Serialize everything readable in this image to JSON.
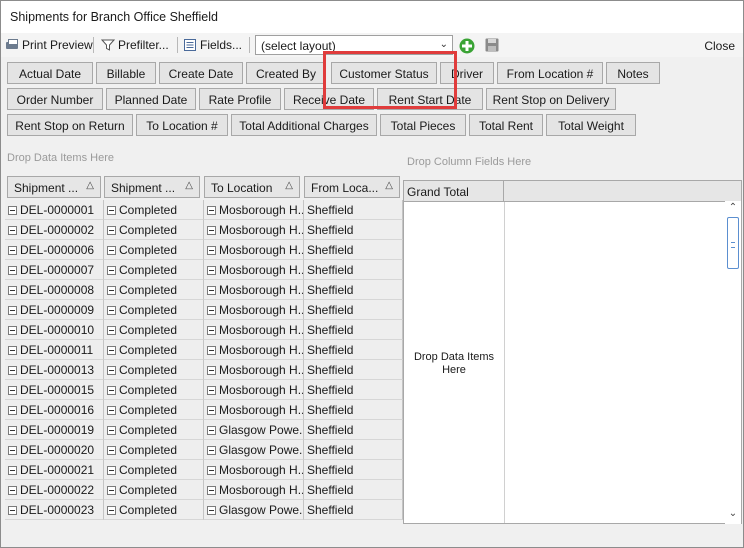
{
  "window": {
    "title": "Shipments for Branch Office Sheffield"
  },
  "toolbar": {
    "print_preview": "Print Preview",
    "prefilter": "Prefilter...",
    "fields": "Fields...",
    "layout_select": "(select layout)",
    "close": "Close"
  },
  "field_buttons": [
    "Actual Date",
    "Billable",
    "Create Date",
    "Created By",
    "Customer Status",
    "Driver",
    "From Location #",
    "Notes",
    "Order Number",
    "Planned Date",
    "Rate Profile",
    "Receive Date",
    "Rent Start Date",
    "Rent Stop on Delivery",
    "Rent Stop on Return",
    "To Location #",
    "Total Additional Charges",
    "Total Pieces",
    "Total Rent",
    "Total Weight"
  ],
  "hints": {
    "drop_data_items": "Drop Data Items Here",
    "drop_column_fields": "Drop Column Fields Here",
    "drop_data_items_pivot": "Drop Data Items Here"
  },
  "grid": {
    "columns": [
      "Shipment ...",
      "Shipment ...",
      "To Location",
      "From Loca..."
    ],
    "rows": [
      [
        "DEL-0000001",
        "Completed",
        "Mosborough H...",
        "Sheffield"
      ],
      [
        "DEL-0000002",
        "Completed",
        "Mosborough H...",
        "Sheffield"
      ],
      [
        "DEL-0000006",
        "Completed",
        "Mosborough H...",
        "Sheffield"
      ],
      [
        "DEL-0000007",
        "Completed",
        "Mosborough H...",
        "Sheffield"
      ],
      [
        "DEL-0000008",
        "Completed",
        "Mosborough H...",
        "Sheffield"
      ],
      [
        "DEL-0000009",
        "Completed",
        "Mosborough H...",
        "Sheffield"
      ],
      [
        "DEL-0000010",
        "Completed",
        "Mosborough H...",
        "Sheffield"
      ],
      [
        "DEL-0000011",
        "Completed",
        "Mosborough H...",
        "Sheffield"
      ],
      [
        "DEL-0000013",
        "Completed",
        "Mosborough H...",
        "Sheffield"
      ],
      [
        "DEL-0000015",
        "Completed",
        "Mosborough H...",
        "Sheffield"
      ],
      [
        "DEL-0000016",
        "Completed",
        "Mosborough H...",
        "Sheffield"
      ],
      [
        "DEL-0000019",
        "Completed",
        "Glasgow Powe...",
        "Sheffield"
      ],
      [
        "DEL-0000020",
        "Completed",
        "Glasgow Powe...",
        "Sheffield"
      ],
      [
        "DEL-0000021",
        "Completed",
        "Mosborough H...",
        "Sheffield"
      ],
      [
        "DEL-0000022",
        "Completed",
        "Mosborough H...",
        "Sheffield"
      ],
      [
        "DEL-0000023",
        "Completed",
        "Glasgow Powe...",
        "Sheffield"
      ]
    ]
  },
  "pivot": {
    "grand_total": "Grand Total"
  },
  "colors": {
    "highlight": "#e03c3c",
    "accent_green": "#3aa335"
  }
}
